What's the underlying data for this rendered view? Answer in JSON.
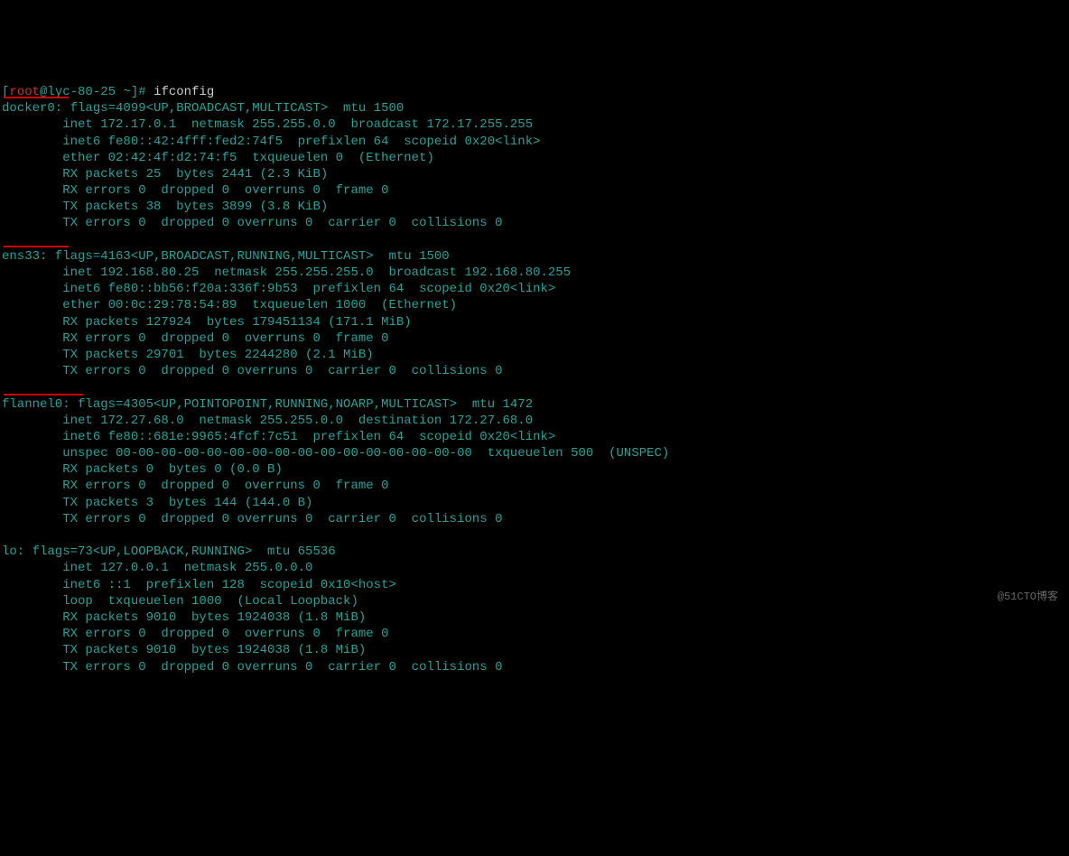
{
  "prompt": {
    "bracket_open": "[",
    "user": "root",
    "at": "@",
    "host": "lyc-80-25",
    "path": " ~",
    "bracket_close": "]#",
    "command": " ifconfig"
  },
  "interfaces": {
    "docker0": {
      "header": "docker0: flags=4099<UP,BROADCAST,MULTICAST>  mtu 1500",
      "lines": [
        "        inet 172.17.0.1  netmask 255.255.0.0  broadcast 172.17.255.255",
        "        inet6 fe80::42:4fff:fed2:74f5  prefixlen 64  scopeid 0x20<link>",
        "        ether 02:42:4f:d2:74:f5  txqueuelen 0  (Ethernet)",
        "        RX packets 25  bytes 2441 (2.3 KiB)",
        "        RX errors 0  dropped 0  overruns 0  frame 0",
        "        TX packets 38  bytes 3899 (3.8 KiB)",
        "        TX errors 0  dropped 0 overruns 0  carrier 0  collisions 0"
      ]
    },
    "ens33": {
      "header": "ens33: flags=4163<UP,BROADCAST,RUNNING,MULTICAST>  mtu 1500",
      "lines": [
        "        inet 192.168.80.25  netmask 255.255.255.0  broadcast 192.168.80.255",
        "        inet6 fe80::bb56:f20a:336f:9b53  prefixlen 64  scopeid 0x20<link>",
        "        ether 00:0c:29:78:54:89  txqueuelen 1000  (Ethernet)",
        "        RX packets 127924  bytes 179451134 (171.1 MiB)",
        "        RX errors 0  dropped 0  overruns 0  frame 0",
        "        TX packets 29701  bytes 2244280 (2.1 MiB)",
        "        TX errors 0  dropped 0 overruns 0  carrier 0  collisions 0"
      ]
    },
    "flannel0": {
      "header": "flannel0: flags=4305<UP,POINTOPOINT,RUNNING,NOARP,MULTICAST>  mtu 1472",
      "lines": [
        "        inet 172.27.68.0  netmask 255.255.0.0  destination 172.27.68.0",
        "        inet6 fe80::681e:9965:4fcf:7c51  prefixlen 64  scopeid 0x20<link>",
        "        unspec 00-00-00-00-00-00-00-00-00-00-00-00-00-00-00-00  txqueuelen 500  (UNSPEC)",
        "        RX packets 0  bytes 0 (0.0 B)",
        "        RX errors 0  dropped 0  overruns 0  frame 0",
        "        TX packets 3  bytes 144 (144.0 B)",
        "        TX errors 0  dropped 0 overruns 0  carrier 0  collisions 0"
      ]
    },
    "lo": {
      "header": "lo: flags=73<UP,LOOPBACK,RUNNING>  mtu 65536",
      "lines": [
        "        inet 127.0.0.1  netmask 255.0.0.0",
        "        inet6 ::1  prefixlen 128  scopeid 0x10<host>",
        "        loop  txqueuelen 1000  (Local Loopback)",
        "        RX packets 9010  bytes 1924038 (1.8 MiB)",
        "        RX errors 0  dropped 0  overruns 0  frame 0",
        "        TX packets 9010  bytes 1924038 (1.8 MiB)",
        "        TX errors 0  dropped 0 overruns 0  carrier 0  collisions 0"
      ]
    }
  },
  "watermark": "@51CTO博客"
}
